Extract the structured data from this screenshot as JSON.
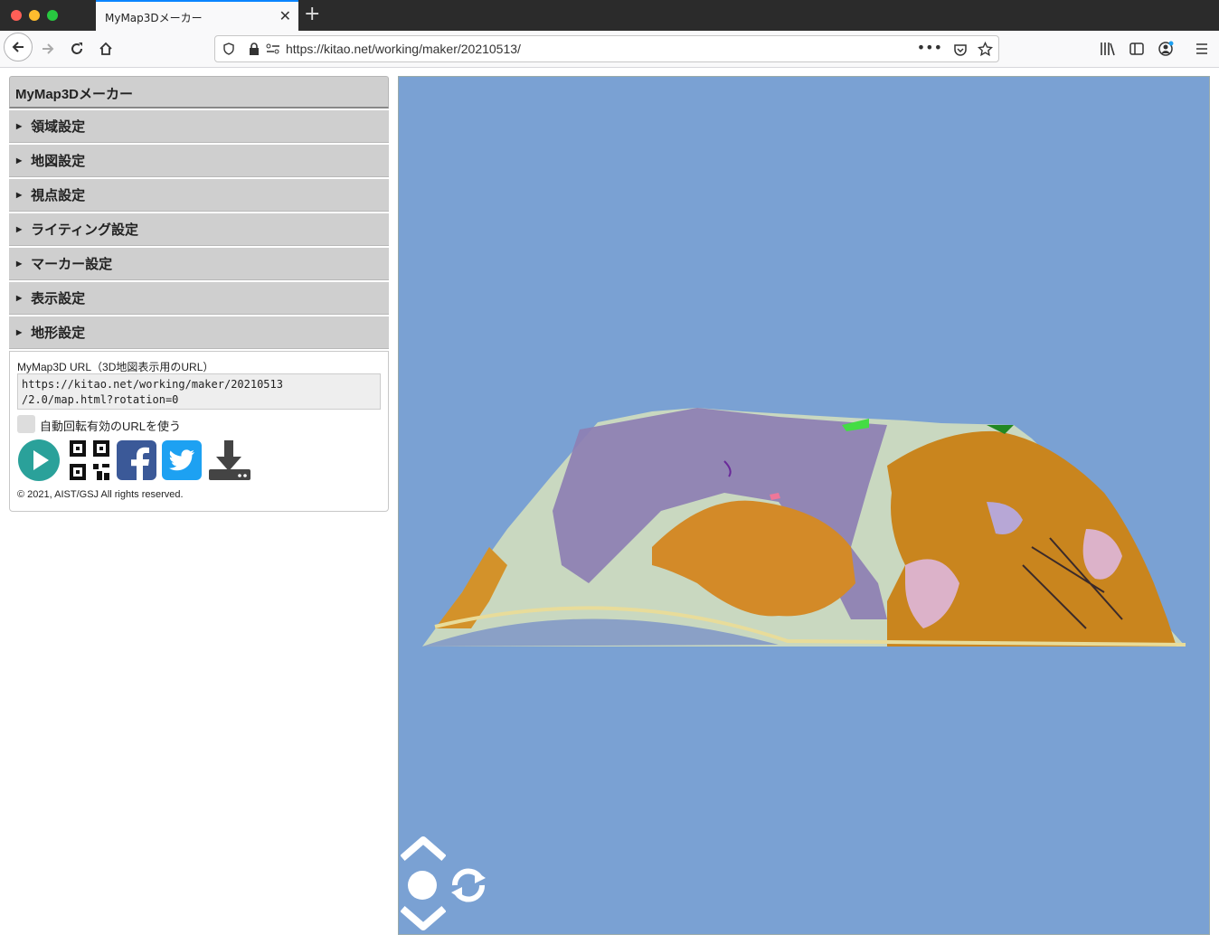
{
  "browser": {
    "tab_title": "MyMap3Dメーカー",
    "url": "https://kitao.net/working/maker/20210513/"
  },
  "sidebar": {
    "title": "MyMap3Dメーカー",
    "items": [
      {
        "label": "領域設定"
      },
      {
        "label": "地図設定"
      },
      {
        "label": "視点設定"
      },
      {
        "label": "ライティング設定"
      },
      {
        "label": "マーカー設定"
      },
      {
        "label": "表示設定"
      },
      {
        "label": "地形設定"
      }
    ]
  },
  "panel": {
    "url_label": "MyMap3D URL（3D地図表示用のURL）",
    "url_value": "https://kitao.net/working/maker/20210513\n/2.0/map.html?rotation=0",
    "checkbox_label": "自動回転有効のURLを使う",
    "copyright": "© 2021, AIST/GSJ All rights reserved."
  },
  "colors": {
    "map_bg": "#7aa1d3",
    "play": "#2aa19a",
    "facebook": "#3b5998",
    "twitter": "#1da1f2",
    "download": "#444444"
  }
}
